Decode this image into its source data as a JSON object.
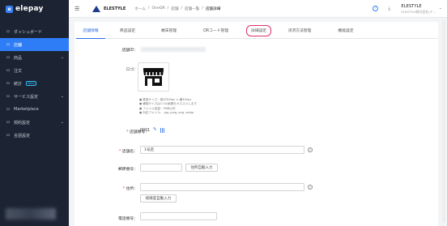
{
  "app": {
    "brand": "elepay",
    "sidebar": {
      "items": [
        {
          "label": "ダッシュボード",
          "icon": "dashboard-icon",
          "active": false,
          "chevron": false,
          "badge": ""
        },
        {
          "label": "店舗",
          "icon": "store-icon",
          "active": true,
          "chevron": false,
          "badge": ""
        },
        {
          "label": "商品",
          "icon": "product-icon",
          "active": false,
          "chevron": true,
          "badge": ""
        },
        {
          "label": "注文",
          "icon": "order-icon",
          "active": false,
          "chevron": false,
          "badge": ""
        },
        {
          "label": "統計",
          "icon": "stats-icon",
          "active": false,
          "chevron": false,
          "badge": "Beta"
        },
        {
          "label": "サービス設定",
          "icon": "service-icon",
          "active": false,
          "chevron": true,
          "badge": ""
        },
        {
          "label": "Marketplace",
          "icon": "marketplace-icon",
          "active": false,
          "chevron": false,
          "badge": ""
        },
        {
          "label": "契約設定",
          "icon": "contract-icon",
          "active": false,
          "chevron": true,
          "badge": ""
        },
        {
          "label": "言語設定",
          "icon": "language-icon",
          "active": false,
          "chevron": false,
          "badge": ""
        }
      ]
    }
  },
  "header": {
    "logo_text": "ELESTYLE",
    "breadcrumbs": [
      "ホーム",
      "/",
      "OneQR",
      "/",
      "店舗",
      "/",
      "店舗一覧",
      "/",
      "店舗詳細"
    ],
    "account_name": "ELESTYLE",
    "account_sub": "ELESTYLE株式会社(テ..."
  },
  "tabs": [
    {
      "label": "店舗情報",
      "active": true,
      "highlight": false
    },
    {
      "label": "商品設定",
      "active": false,
      "highlight": false
    },
    {
      "label": "端末管理",
      "active": false,
      "highlight": false
    },
    {
      "label": "QRコード管理",
      "active": false,
      "highlight": false
    },
    {
      "label": "詳細設定",
      "active": false,
      "highlight": true
    },
    {
      "label": "決済方法管理",
      "active": false,
      "highlight": false
    },
    {
      "label": "機能設定",
      "active": false,
      "highlight": false
    }
  ],
  "form": {
    "store_id_label": "店舗ID：",
    "logo_label": "ロゴ：",
    "logo_notes": [
      "● 推奨サイズ：縦が300px × 横300px",
      "● 横縦サイズは1:1の画像をオススメします",
      "● ファイル容量：5MB以内",
      "● 対応ファイル：.jpg,.jpeg,.png,.webp"
    ],
    "store_number_label": "店舗番号：",
    "store_number_value": "0001",
    "store_name_label": "店舗名：",
    "store_name_value": "1号店",
    "postal_label": "郵便番号：",
    "postal_button": "住所自動入力",
    "address_label": "住所：",
    "geo_button": "経緯度自動入力",
    "phone_label": "電話番号："
  },
  "colors": {
    "accent": "#2f7df6",
    "sidebar_bg": "#1c2433",
    "highlight_ring": "#e0306d"
  }
}
